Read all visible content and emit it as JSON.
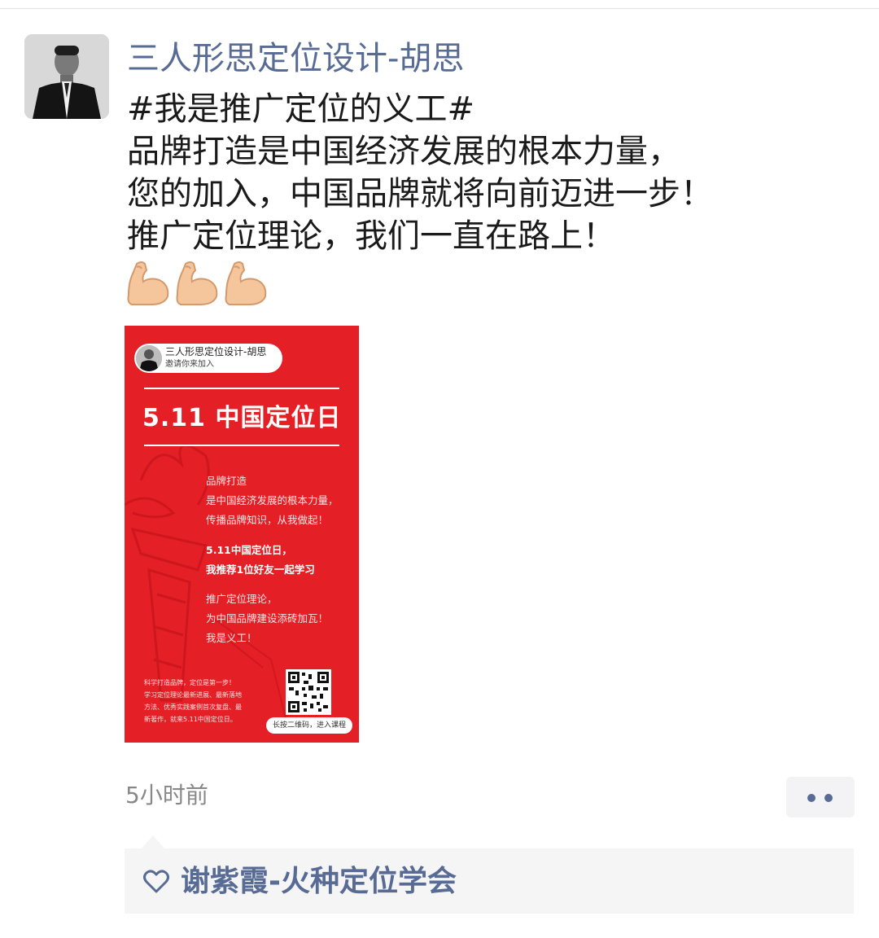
{
  "post": {
    "author_name": "三人形思定位设计-胡思",
    "text_lines": [
      "#我是推广定位的义工#",
      "品牌打造是中国经济发展的根本力量，",
      "您的加入，中国品牌就将向前迈进一步！",
      "推广定位理论，我们一直在路上！"
    ],
    "emoji": [
      "flexed-biceps",
      "flexed-biceps",
      "flexed-biceps"
    ],
    "timestamp": "5小时前"
  },
  "poster": {
    "inviter_name": "三人形思定位设计-胡思",
    "invite_text": "邀请你来加入",
    "title": "5.11 中国定位日",
    "body_lines": [
      "品牌打造",
      "是中国经济发展的根本力量，",
      "传播品牌知识，从我做起！",
      "5.11中国定位日，",
      "我推荐1位好友一起学习",
      "推广定位理论，",
      "为中国品牌建设添砖加瓦！",
      "我是义工！"
    ],
    "small_lines": [
      "科学打造品牌，定位是第一步！",
      "学习定位理论最新进展、最新落地",
      "方法、优秀实践案例首次复盘、最",
      "新著作，就来5.11中国定位日。"
    ],
    "qr_caption": "长按二维码，进入课程",
    "background_color": "#e41f26"
  },
  "likes": {
    "names": "谢紫霞-火种定位学会"
  },
  "colors": {
    "link": "#576b95",
    "timestamp": "#888888",
    "like_bg": "#f5f5f5"
  }
}
